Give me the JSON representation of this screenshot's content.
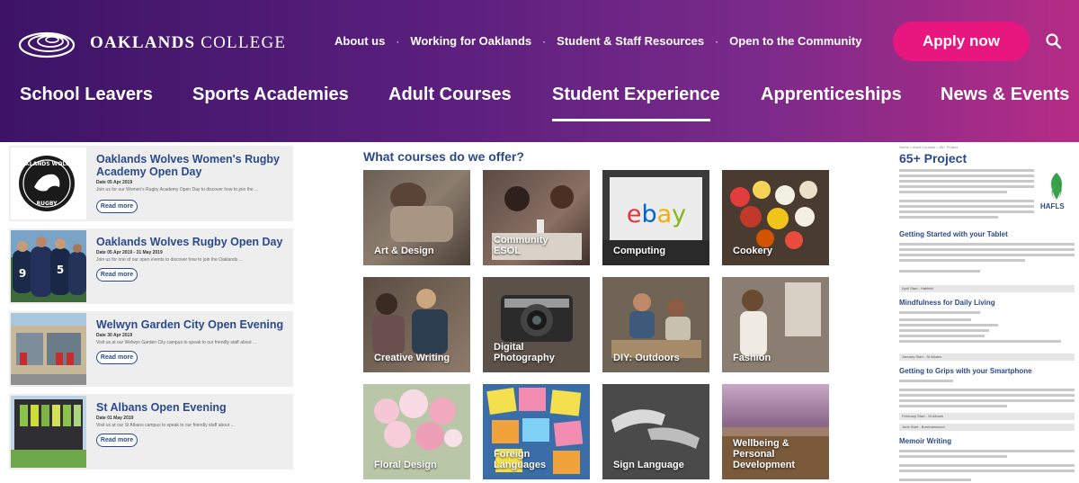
{
  "header": {
    "logo_text_bold": "OAKLANDS",
    "logo_text_rest": " COLLEGE",
    "utility_links": [
      "About us",
      "Working for Oaklands",
      "Student & Staff Resources",
      "Open to the Community"
    ],
    "apply_label": "Apply now",
    "search_icon": "search-icon",
    "main_nav": [
      "School Leavers",
      "Sports Academies",
      "Adult Courses",
      "Student Experience",
      "Apprenticeships",
      "News & Events"
    ],
    "active_nav": "Student Experience"
  },
  "events": [
    {
      "title": "Oaklands Wolves Women's Rugby Academy Open Day",
      "date": "Date 05 Apr 2019",
      "desc": "Join us for our Women's Rugby Academy Open Day to discover how to join the ...",
      "read_more": "Read more"
    },
    {
      "title": "Oaklands Wolves Rugby Open Day",
      "date": "Date 05 Apr 2019 - 31 May 2019",
      "desc": "Join us for one of our open events to discover how to join the Oaklands ...",
      "read_more": "Read more"
    },
    {
      "title": "Welwyn Garden City Open Evening",
      "date": "Date 30 Apr 2019",
      "desc": "Visit us at our Welwyn Garden City campus to speak to our friendly staff about ...",
      "read_more": "Read more"
    },
    {
      "title": "St Albans Open Evening",
      "date": "Date 01 May 2019",
      "desc": "Visit us at our St Albans campus to speak to our friendly staff about ...",
      "read_more": "Read more"
    }
  ],
  "courses": {
    "title": "What courses do we offer?",
    "tiles": [
      {
        "label": "Art & Design"
      },
      {
        "label": "Community\nESOL"
      },
      {
        "label": "Computing",
        "logo": "ebay"
      },
      {
        "label": "Cookery"
      },
      {
        "label": "Creative Writing"
      },
      {
        "label": "Digital\nPhotography"
      },
      {
        "label": "DIY: Outdoors"
      },
      {
        "label": "Fashion"
      },
      {
        "label": "Floral Design"
      },
      {
        "label": "Foreign\nLanguages"
      },
      {
        "label": "Sign Language"
      },
      {
        "label": "Wellbeing &\nPersonal\nDevelopment"
      }
    ]
  },
  "project": {
    "breadcrumb": "Home > Adult Courses > 65+ Project",
    "title": "65+ Project",
    "logo_text": "HAFLS",
    "sections": [
      "Getting Started with your Tablet",
      "Mindfulness for Daily Living",
      "Getting to Grips with your Smartphone",
      "Memoir Writing"
    ],
    "selects": [
      "April Start - Hatfield",
      "January Start - St Albans",
      "February Start - St Albans",
      "June Start - Borehamwood"
    ]
  }
}
